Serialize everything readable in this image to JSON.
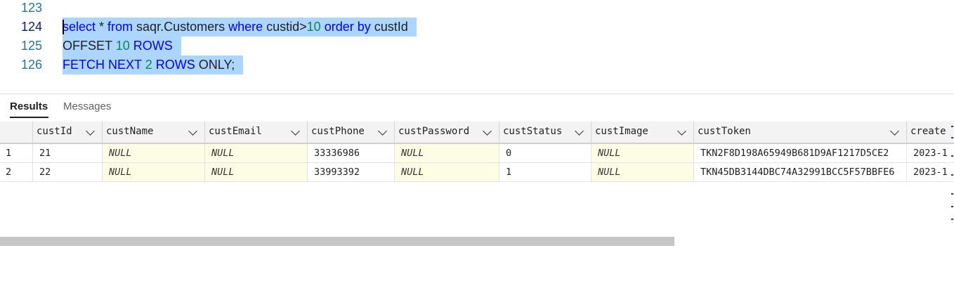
{
  "editor": {
    "lines": [
      {
        "number": "123",
        "segments": []
      },
      {
        "number": "124",
        "segments": [
          {
            "text": "select",
            "type": "kw"
          },
          {
            "text": " * ",
            "type": "id"
          },
          {
            "text": "from",
            "type": "kw"
          },
          {
            "text": " saqr.Customers ",
            "type": "id"
          },
          {
            "text": "where",
            "type": "kw"
          },
          {
            "text": " custid>",
            "type": "id"
          },
          {
            "text": "10",
            "type": "num"
          },
          {
            "text": " ",
            "type": "id"
          },
          {
            "text": "order by",
            "type": "kw"
          },
          {
            "text": " custId",
            "type": "id"
          }
        ]
      },
      {
        "number": "125",
        "segments": [
          {
            "text": "OFFSET ",
            "type": "id"
          },
          {
            "text": "10",
            "type": "num"
          },
          {
            "text": " ",
            "type": "id"
          },
          {
            "text": "ROWS",
            "type": "kw"
          }
        ]
      },
      {
        "number": "126",
        "segments": [
          {
            "text": "FETCH NEXT ",
            "type": "kw"
          },
          {
            "text": "2",
            "type": "num"
          },
          {
            "text": " ",
            "type": "id"
          },
          {
            "text": "ROWS",
            "type": "kw"
          },
          {
            "text": " ONLY;",
            "type": "id"
          }
        ]
      }
    ]
  },
  "tabs": {
    "results": "Results",
    "messages": "Messages"
  },
  "grid": {
    "columns": [
      "custId",
      "custName",
      "custEmail",
      "custPhone",
      "custPassword",
      "custStatus",
      "custImage",
      "custToken",
      "create"
    ],
    "rows": [
      {
        "num": "1",
        "cells": [
          "21",
          "NULL",
          "NULL",
          "33336986",
          "NULL",
          "0",
          "NULL",
          "TKN2F8D198A65949B681D9AF1217D5CE2",
          "2023-1"
        ]
      },
      {
        "num": "2",
        "cells": [
          "22",
          "NULL",
          "NULL",
          "33993392",
          "NULL",
          "1",
          "NULL",
          "TKN45DB3144DBC74A32991BCC5F57BBFE6",
          "2023-1"
        ]
      }
    ]
  },
  "colors": {
    "keyword": "#0000ff",
    "number": "#098658",
    "selection": "#add6ff",
    "line_number": "#237893",
    "null_cell": "#fdfde6"
  }
}
